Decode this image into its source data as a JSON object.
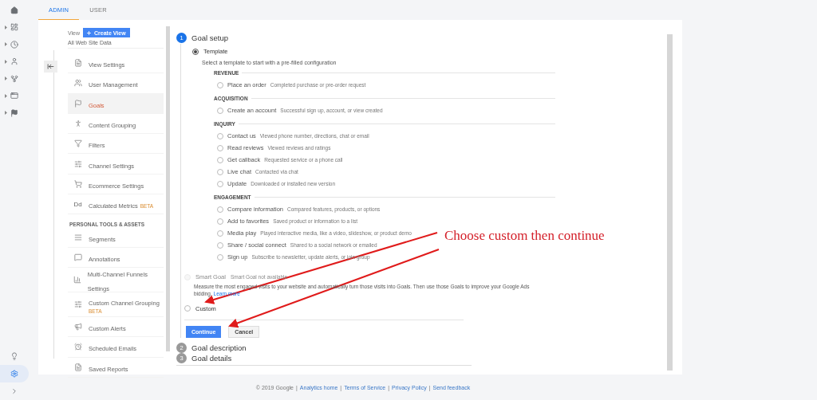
{
  "rail": {
    "items": [
      {
        "kind": "home",
        "expandable": false
      },
      {
        "kind": "dashboard",
        "expandable": true
      },
      {
        "kind": "clock",
        "expandable": true
      },
      {
        "kind": "person",
        "expandable": true
      },
      {
        "kind": "branch",
        "expandable": true
      },
      {
        "kind": "window",
        "expandable": true
      },
      {
        "kind": "flag",
        "expandable": true
      }
    ],
    "bottom": [
      {
        "kind": "bulb",
        "selected": false
      },
      {
        "kind": "gear",
        "selected": true
      },
      {
        "kind": "chevron",
        "selected": false
      }
    ]
  },
  "tabs": [
    {
      "label": "ADMIN",
      "selected": true
    },
    {
      "label": "USER",
      "selected": false
    }
  ],
  "view": {
    "label": "View",
    "create_button": "Create View",
    "name": "All Web Site Data"
  },
  "nav": {
    "items": [
      {
        "kind": "item",
        "label": "View Settings",
        "selected": false
      },
      {
        "kind": "item",
        "label": "User Management",
        "selected": false
      },
      {
        "kind": "item",
        "label": "Goals",
        "selected": true
      },
      {
        "kind": "item",
        "label": "Content Grouping",
        "selected": false
      },
      {
        "kind": "item",
        "label": "Filters",
        "selected": false
      },
      {
        "kind": "item",
        "label": "Channel Settings",
        "selected": false
      },
      {
        "kind": "item",
        "label": "Ecommerce Settings",
        "selected": false
      },
      {
        "kind": "item",
        "icon_text": "Dd",
        "label": "Calculated Metrics",
        "badge": "BETA",
        "selected": false
      },
      {
        "kind": "section",
        "label": "PERSONAL TOOLS & ASSETS"
      },
      {
        "kind": "item",
        "label": "Segments",
        "selected": false
      },
      {
        "kind": "item",
        "label": "Annotations",
        "selected": false
      },
      {
        "kind": "item",
        "label": "Multi-Channel Funnels Settings",
        "selected": false
      },
      {
        "kind": "item",
        "label": "Custom Channel Grouping",
        "badge": "BETA",
        "badge_below": true,
        "selected": false
      },
      {
        "kind": "item",
        "label": "Custom Alerts",
        "selected": false
      },
      {
        "kind": "item",
        "label": "Scheduled Emails",
        "selected": false
      },
      {
        "kind": "item",
        "label": "Saved Reports",
        "selected": false
      }
    ]
  },
  "goal_setup": {
    "step": "1",
    "title": "Goal setup",
    "template": {
      "label": "Template",
      "selected": true,
      "hint": "Select a template to start with a pre-filled configuration",
      "categories": [
        {
          "name": "REVENUE",
          "options": [
            {
              "label": "Place an order",
              "description": "Completed purchase or pre-order request",
              "selected": false
            }
          ]
        },
        {
          "name": "ACQUISITION",
          "options": [
            {
              "label": "Create an account",
              "description": "Successful sign up, account, or view created",
              "selected": false
            }
          ]
        },
        {
          "name": "INQUIRY",
          "options": [
            {
              "label": "Contact us",
              "description": "Viewed phone number, directions, chat or email",
              "selected": false
            },
            {
              "label": "Read reviews",
              "description": "Viewed reviews and ratings",
              "selected": false
            },
            {
              "label": "Get callback",
              "description": "Requested service or a phone call",
              "selected": false
            },
            {
              "label": "Live chat",
              "description": "Contacted via chat",
              "selected": false
            },
            {
              "label": "Update",
              "description": "Downloaded or installed new version",
              "selected": false
            }
          ]
        },
        {
          "name": "ENGAGEMENT",
          "options": [
            {
              "label": "Compare information",
              "description": "Compared features, products, or options",
              "selected": false
            },
            {
              "label": "Add to favorites",
              "description": "Saved product or information to a list",
              "selected": false
            },
            {
              "label": "Media play",
              "description": "Played interactive media, like a video, slideshow, or product demo",
              "selected": false
            },
            {
              "label": "Share / social connect",
              "description": "Shared to a social network or emailed",
              "selected": false
            },
            {
              "label": "Sign up",
              "description": "Subscribe to newsletter, update alerts, or join group",
              "selected": false
            }
          ]
        }
      ]
    },
    "smart_goal": {
      "label": "Smart Goal",
      "note": "Smart Goal not available",
      "disabled": true,
      "selected": false,
      "description": "Measure the most engaged visits to your website and automatically turn those visits into Goals. Then use those Goals to improve your Google Ads bidding.",
      "link": "Learn more"
    },
    "custom": {
      "label": "Custom",
      "selected": false
    },
    "buttons": [
      {
        "kind": "primary",
        "label": "Continue"
      },
      {
        "kind": "secondary",
        "label": "Cancel"
      }
    ]
  },
  "next_steps": [
    {
      "step": "2",
      "title": "Goal description"
    },
    {
      "step": "3",
      "title": "Goal details"
    }
  ],
  "annotation": {
    "text": "Choose custom then continue"
  },
  "footer": {
    "copyright": "© 2019 Google",
    "separator": "|",
    "links": [
      "Analytics home",
      "Terms of Service",
      "Privacy Policy",
      "Send feedback"
    ]
  }
}
